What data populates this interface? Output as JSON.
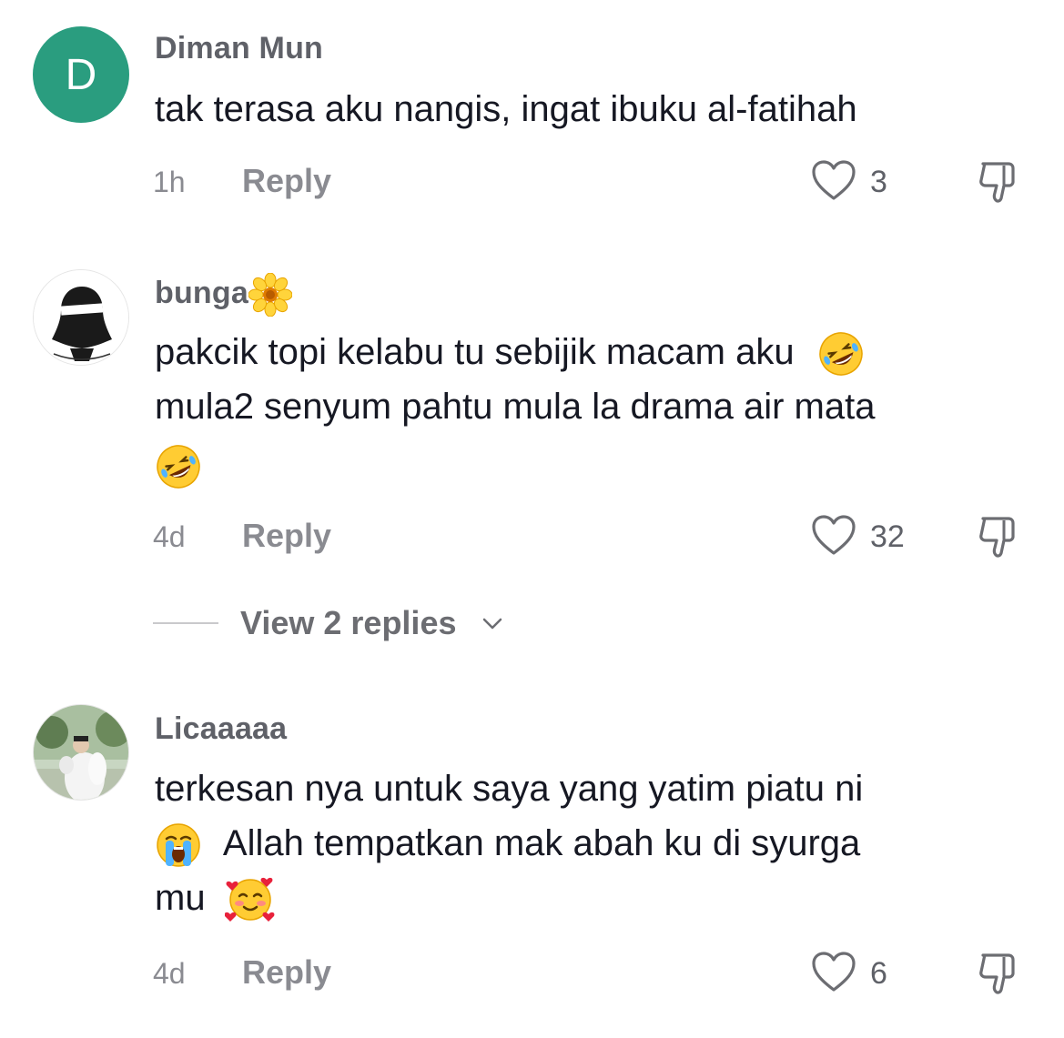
{
  "comments": [
    {
      "username": "Diman Mun",
      "avatar_letter": "D",
      "lines": [
        "tak terasa aku nangis, ingat ibuku al-fatihah"
      ],
      "time": "1h",
      "reply_label": "Reply",
      "likes": "3"
    },
    {
      "username": "bunga",
      "username_emoji": "sunflower-emoji",
      "lines": [
        "pakcik topi kelabu tu sebijik macam aku",
        "mula2 senyum pahtu mula la drama air mata"
      ],
      "line_emojis": [
        "rolling-laughing-emoji"
      ],
      "time": "4d",
      "reply_label": "Reply",
      "likes": "32",
      "view_replies": "View 2 replies"
    },
    {
      "username": "Licaaaaa",
      "lines": [
        "terkesan nya untuk saya yang yatim piatu ni",
        "Allah tempatkan mak abah ku di syurga",
        "mu"
      ],
      "line_emojis": [
        "loudly-crying-emoji",
        "smiling-hearts-emoji"
      ],
      "time": "4d",
      "reply_label": "Reply",
      "likes": "6"
    }
  ],
  "colors": {
    "avatar_d": "#2a9d7f",
    "text": "#161823",
    "muted": "#8a8b91"
  }
}
